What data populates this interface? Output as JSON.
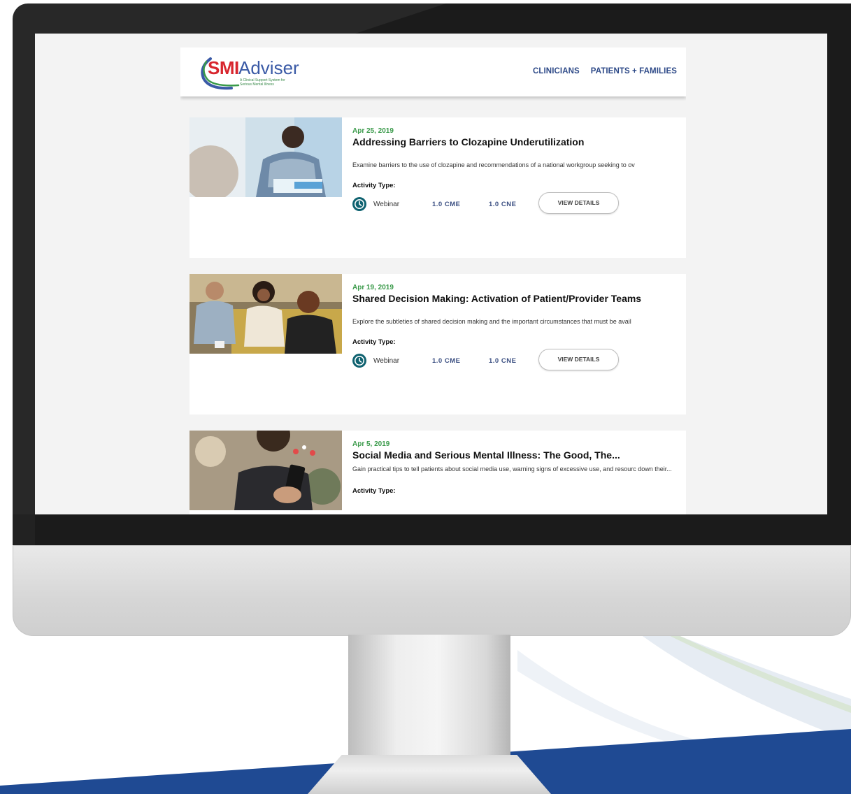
{
  "site": {
    "logo": {
      "smi": "SMI",
      "adviser": "Adviser",
      "tagline": "A Clinical Support System for Serious Mental Illness"
    },
    "nav": [
      {
        "label": "CLINICIANS"
      },
      {
        "label": "PATIENTS + FAMILIES"
      }
    ]
  },
  "activities": [
    {
      "date": "Apr 25, 2019",
      "title": "Addressing Barriers to Clozapine Underutilization",
      "description": "Examine barriers to the use of clozapine and recommendations of a national workgroup seeking to ov",
      "activity_type_label": "Activity Type:",
      "format": "Webinar",
      "cme": "1.0 CME",
      "cne": "1.0 CNE",
      "button": "VIEW DETAILS",
      "icon": "clock-icon"
    },
    {
      "date": "Apr 19, 2019",
      "title": "Shared Decision Making: Activation of Patient/Provider Teams",
      "description": "Explore the subtleties of shared decision making and the important circumstances that must be avail",
      "activity_type_label": "Activity Type:",
      "format": "Webinar",
      "cme": "1.0 CME",
      "cne": "1.0 CNE",
      "button": "VIEW DETAILS",
      "icon": "clock-icon"
    },
    {
      "date": "Apr 5, 2019",
      "title": "Social Media and Serious Mental Illness: The Good, The...",
      "description": "Gain practical tips to tell patients about social media use, warning signs of excessive use, and resourc down their...",
      "activity_type_label": "Activity Type:"
    }
  ],
  "colors": {
    "brand_blue": "#2e4a88",
    "date_green": "#3a9a4a",
    "icon_teal": "#0f6270",
    "logo_red": "#d8262e",
    "background_navy": "#1f4a93"
  }
}
